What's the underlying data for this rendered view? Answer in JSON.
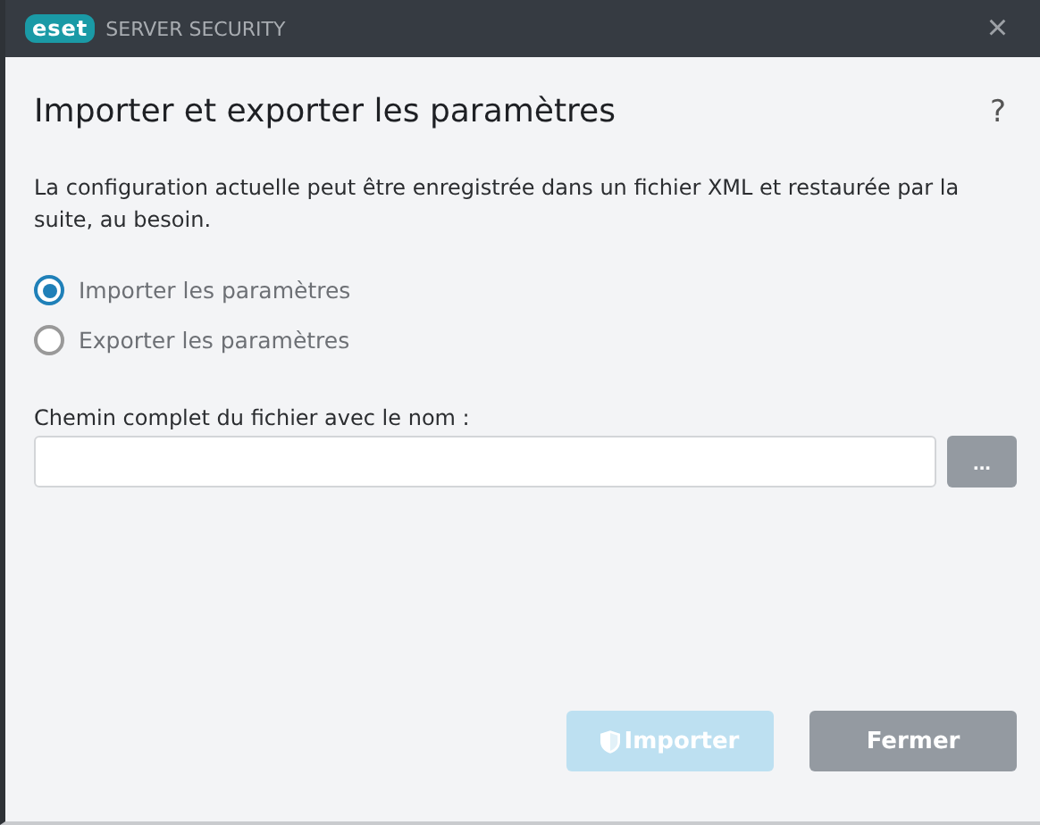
{
  "window": {
    "logo": "eset",
    "title": "SERVER SECURITY",
    "close": "×"
  },
  "heading": "Importer et exporter les paramètres",
  "help": "?",
  "description": "La configuration actuelle peut être enregistrée dans un fichier XML et restaurée par la suite, au besoin.",
  "options": [
    {
      "label": "Importer les paramètres",
      "selected": true
    },
    {
      "label": "Exporter les paramètres",
      "selected": false
    }
  ],
  "path_field": {
    "label": "Chemin complet du fichier avec le nom :",
    "browse": "..."
  },
  "buttons": [
    {
      "label": "Importer",
      "kind": "primary",
      "disabled": true
    },
    {
      "label": "Fermer",
      "kind": "secondary",
      "disabled": false
    }
  ]
}
